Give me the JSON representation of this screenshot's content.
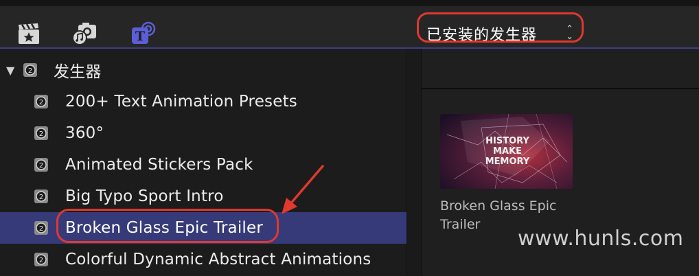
{
  "toolbar": {
    "icons": [
      "clapboard-star-icon",
      "camera-music-icon",
      "titles-generators-icon"
    ],
    "generator_select": {
      "value": "已安装的发生器",
      "chevron": "⌃\n⌄"
    }
  },
  "sidebar": {
    "root": {
      "label": "发生器",
      "expanded": true
    },
    "items": [
      {
        "label": "200+ Text Animation Presets",
        "selected": false
      },
      {
        "label": "360°",
        "selected": false
      },
      {
        "label": "Animated Stickers Pack",
        "selected": false
      },
      {
        "label": "Big Typo Sport Intro",
        "selected": false
      },
      {
        "label": "Broken Glass Epic Trailer",
        "selected": true
      },
      {
        "label": "Colorful Dynamic Abstract Animations",
        "selected": false
      }
    ]
  },
  "browser": {
    "thumbnail": {
      "caption_line1": "Broken Glass Epic",
      "caption_line2": "Trailer",
      "overlay_text": [
        "HISTORY",
        "MAKE",
        "MEMORY"
      ]
    }
  },
  "watermark": "www.hunls.com",
  "colors": {
    "selection": "#363a78",
    "annotation": "#e0392e",
    "accent": "#5b5fd6"
  }
}
